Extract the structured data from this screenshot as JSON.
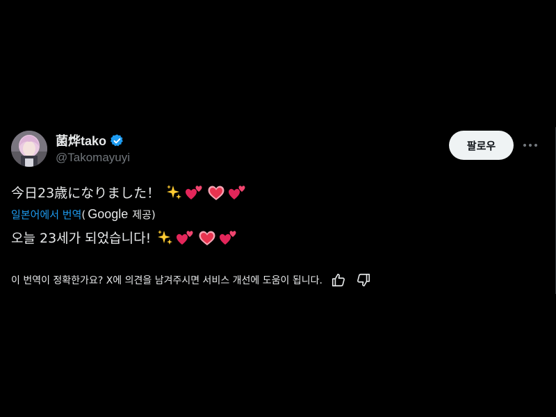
{
  "user": {
    "display_name": "菌烨tako",
    "handle": "@Takomayuyi",
    "verified": true,
    "verified_color": "#1d9bf0"
  },
  "actions": {
    "follow_label": "팔로우",
    "more_icon": "more-horizontal-icon"
  },
  "tweet": {
    "text": "今日23歳になりました！",
    "emojis": [
      "sparkles",
      "two-hearts",
      "heart",
      "two-hearts"
    ]
  },
  "translation": {
    "translated_from": "일본어에서 번역",
    "paren_open": "(",
    "provider": "Google",
    "provided_label": "제공)",
    "text": "오늘 23세가 되었습니다!",
    "emojis": [
      "sparkles",
      "two-hearts",
      "heart",
      "two-hearts"
    ]
  },
  "feedback": {
    "question": "이 번역이 정확한가요? X에 의견을 남겨주시면 서비스 개선에 도움이 됩니다.",
    "thumbs_up_icon": "thumbs-up-icon",
    "thumbs_down_icon": "thumbs-down-icon"
  },
  "colors": {
    "background": "#000000",
    "text": "#e7e9ea",
    "muted": "#71767b",
    "link": "#1d9bf0",
    "button_bg": "#eff3f4",
    "button_text": "#0f1419"
  }
}
